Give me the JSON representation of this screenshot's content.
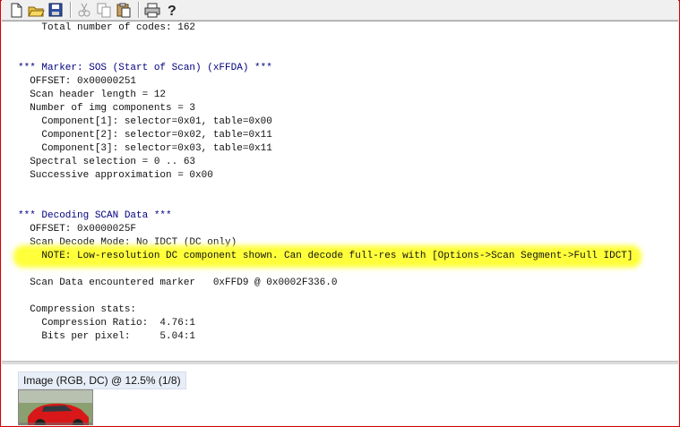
{
  "toolbar": {
    "buttons": [
      {
        "name": "new-icon"
      },
      {
        "name": "open-folder-icon"
      },
      {
        "name": "save-icon"
      },
      {
        "name": "cut-icon"
      },
      {
        "name": "copy-icon"
      },
      {
        "name": "paste-icon"
      },
      {
        "name": "print-icon"
      },
      {
        "name": "help-icon"
      }
    ]
  },
  "log": {
    "lines": [
      "    Total number of codes: 162",
      "",
      "",
      "*** Marker: SOS (Start of Scan) (xFFDA) ***",
      "  OFFSET: 0x00000251",
      "  Scan header length = 12",
      "  Number of img components = 3",
      "    Component[1]: selector=0x01, table=0x00",
      "    Component[2]: selector=0x02, table=0x11",
      "    Component[3]: selector=0x03, table=0x11",
      "  Spectral selection = 0 .. 63",
      "  Successive approximation = 0x00",
      "",
      "",
      "*** Decoding SCAN Data ***",
      "  OFFSET: 0x0000025F",
      "  Scan Decode Mode: No IDCT (DC only)",
      "    NOTE: Low-resolution DC component shown. Can decode full-res with [Options->Scan Segment->Full IDCT]",
      "",
      "  Scan Data encountered marker   0xFFD9 @ 0x0002F336.0",
      "",
      "  Compression stats:",
      "    Compression Ratio:  4.76:1",
      "    Bits per pixel:     5.04:1"
    ]
  },
  "image_panel": {
    "label": "Image (RGB, DC) @ 12.5% (1/8)"
  },
  "colors": {
    "frame_border": "#e00000",
    "header_text": "#000080",
    "highlight": "#ffff3a"
  }
}
